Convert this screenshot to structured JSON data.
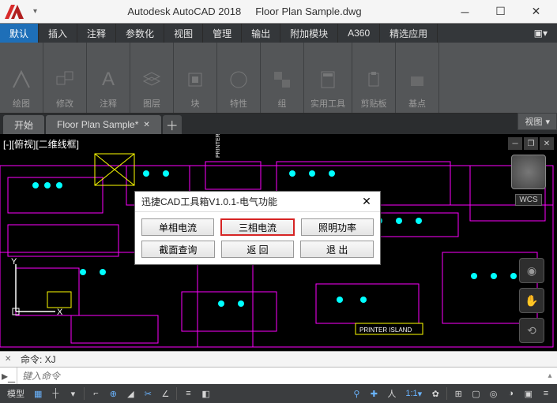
{
  "title": {
    "app": "Autodesk AutoCAD 2018",
    "file": "Floor Plan Sample.dwg"
  },
  "menus": [
    "默认",
    "插入",
    "注释",
    "参数化",
    "视图",
    "管理",
    "输出",
    "附加模块",
    "A360",
    "精选应用"
  ],
  "ribbon": [
    {
      "label": "绘图"
    },
    {
      "label": "修改"
    },
    {
      "label": "注释"
    },
    {
      "label": "图层"
    },
    {
      "label": "块"
    },
    {
      "label": "特性"
    },
    {
      "label": "组"
    },
    {
      "label": "实用工具"
    },
    {
      "label": "剪贴板"
    },
    {
      "label": "基点"
    }
  ],
  "view_label": "视图",
  "filetabs": [
    {
      "label": "开始",
      "closable": false
    },
    {
      "label": "Floor Plan Sample*",
      "closable": true
    }
  ],
  "viewport_label": "[-][俯视][二维线框]",
  "wcs": "WCS",
  "printer_label": "PRINTER ISLAND",
  "dialog": {
    "title": "迅捷CAD工具箱V1.0.1-电气功能",
    "row1": [
      "单相电流",
      "三相电流",
      "照明功率"
    ],
    "row2": [
      "截面查询",
      "返  回",
      "退  出"
    ],
    "highlight_index": 1
  },
  "cmd": {
    "history": "命令: XJ",
    "placeholder": "键入命令"
  },
  "status": {
    "model": "模型",
    "scale": "1:1"
  }
}
